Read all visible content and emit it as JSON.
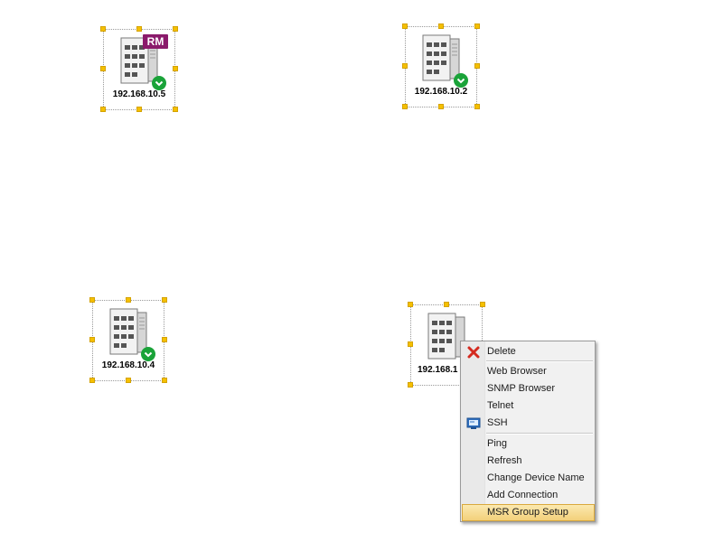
{
  "devices": [
    {
      "ip": "192.168.10.5",
      "status": "ok",
      "badge": "RM"
    },
    {
      "ip": "192.168.10.2",
      "status": "ok"
    },
    {
      "ip": "192.168.10.4",
      "status": "ok"
    },
    {
      "ip": "192.168.1",
      "status": "ok"
    }
  ],
  "context_menu": {
    "items": [
      {
        "label": "Delete",
        "icon": "delete-x-icon"
      },
      {
        "label": "Web Browser"
      },
      {
        "label": "SNMP Browser"
      },
      {
        "label": "Telnet"
      },
      {
        "label": "SSH",
        "icon": "terminal-icon"
      },
      {
        "label": "Ping"
      },
      {
        "label": "Refresh"
      },
      {
        "label": "Change Device Name"
      },
      {
        "label": "Add Connection"
      },
      {
        "label": "MSR Group Setup",
        "highlighted": true
      }
    ]
  },
  "colors": {
    "selection_handle": "#f5c000",
    "status_ok": "#1aa339",
    "rm_badge": "#8b1a6b",
    "menu_highlight": "#f3d07a"
  }
}
